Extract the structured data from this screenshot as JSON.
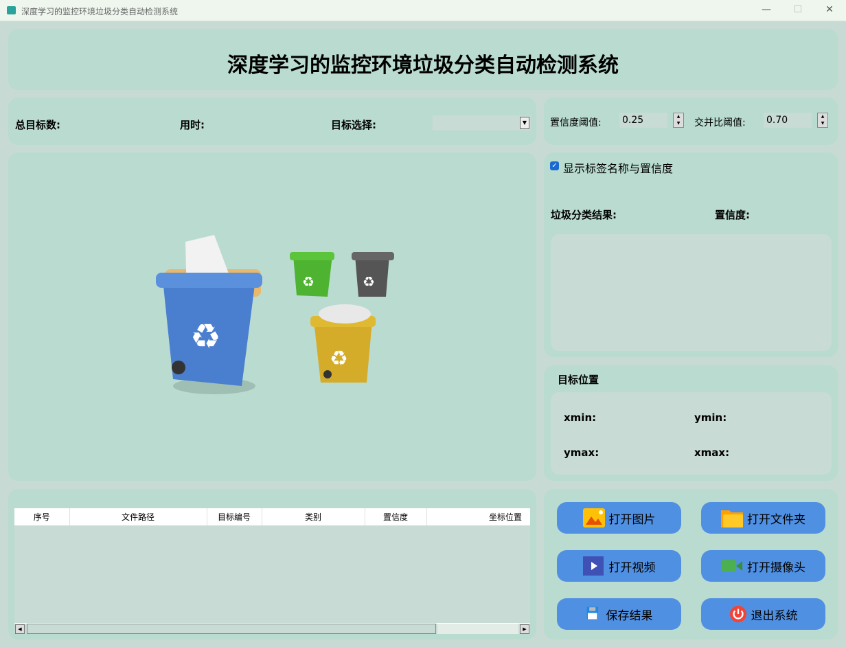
{
  "window": {
    "title": "深度学习的监控环境垃圾分类自动检测系统",
    "minimize": "—",
    "maximize": "☐",
    "close": "✕"
  },
  "header": {
    "title": "深度学习的监控环境垃圾分类自动检测系统"
  },
  "stats": {
    "total_label": "总目标数:",
    "time_label": "用时:",
    "target_select_label": "目标选择:",
    "target_select_value": ""
  },
  "thresholds": {
    "conf_label": "置信度阈值:",
    "conf_value": "0.25",
    "iou_label": "交并比阈值:",
    "iou_value": "0.70"
  },
  "options": {
    "show_label": "显示标签名称与置信度",
    "show_checked": true
  },
  "result": {
    "class_label": "垃圾分类结果:",
    "conf_label": "置信度:"
  },
  "position": {
    "title": "目标位置",
    "xmin": "xmin:",
    "ymin": "ymin:",
    "ymax": "ymax:",
    "xmax": "xmax:"
  },
  "table": {
    "columns": [
      "序号",
      "文件路径",
      "目标编号",
      "类别",
      "置信度",
      "坐标位置"
    ],
    "rows": []
  },
  "buttons": {
    "open_image": "打开图片",
    "open_folder": "打开文件夹",
    "open_video": "打开视频",
    "open_camera": "打开摄像头",
    "save": "保存结果",
    "exit": "退出系统"
  },
  "colors": {
    "panel": "#badbd0",
    "button": "#5090e2",
    "background": "#c7dbd4"
  }
}
